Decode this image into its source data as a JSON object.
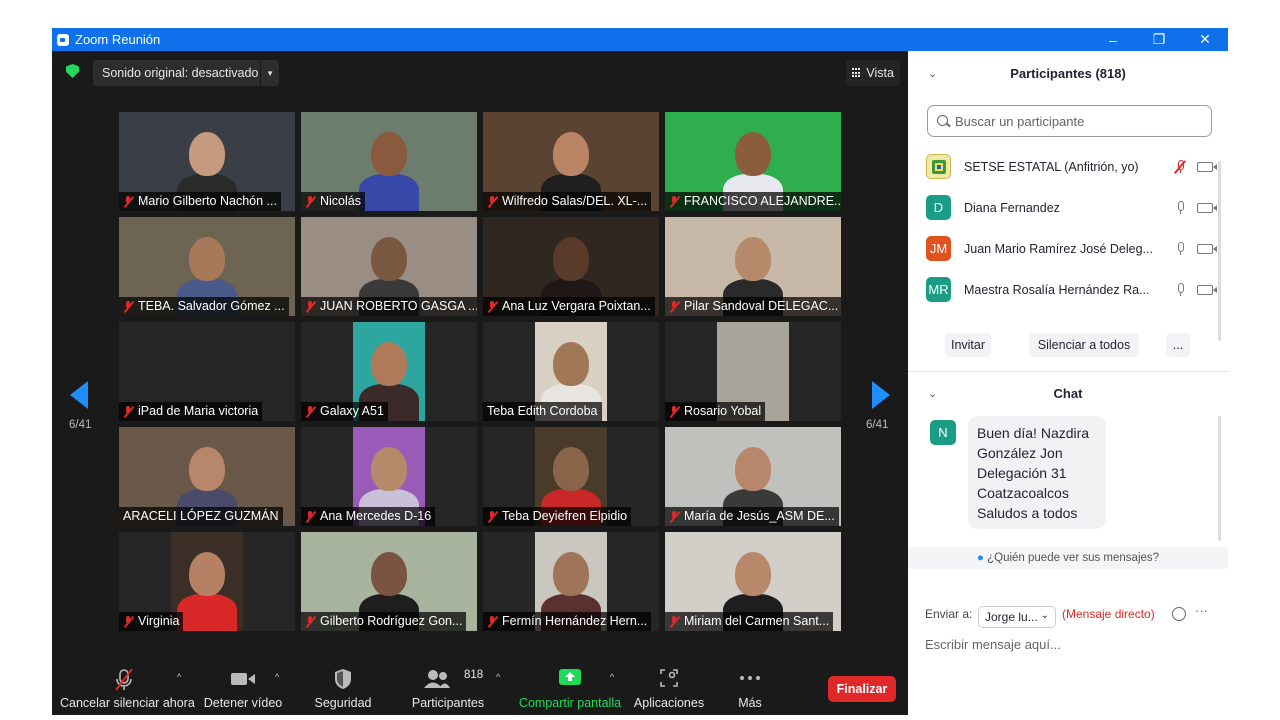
{
  "window": {
    "title": "Zoom Reunión",
    "controls": [
      "–",
      "❐",
      "✕"
    ]
  },
  "topbar": {
    "sound": "Sonido original: desactivado",
    "view": "Vista"
  },
  "pager": {
    "left": "6/41",
    "right": "6/41"
  },
  "tiles": [
    {
      "name": "Mario Gilberto Nachón ...",
      "muted": true,
      "bg": "#3a3f47",
      "skin": "#c69a7e",
      "shirt": "#2a2a2a"
    },
    {
      "name": "Nicolás",
      "muted": true,
      "bg": "#6c7d6e",
      "skin": "#8a5a3e",
      "shirt": "#3648a8"
    },
    {
      "name": "Wilfredo Salas/DEL. XL-...",
      "muted": true,
      "bg": "#5a4330",
      "skin": "#b98565",
      "shirt": "#1e1e1e"
    },
    {
      "name": "FRANCISCO ALEJANDRE...",
      "muted": true,
      "bg": "#2fae4e",
      "skin": "#8c5c3e",
      "shirt": "#e8e8f0"
    },
    {
      "name": "TEBA. Salvador Gómez ...",
      "muted": true,
      "bg": "#6e6452",
      "skin": "#a8785a",
      "shirt": "#4a5a8a"
    },
    {
      "name": "JUAN ROBERTO GASGA ...",
      "muted": true,
      "bg": "#9a8e84",
      "skin": "#7a5840",
      "shirt": "#3a3a3a"
    },
    {
      "name": "Ana Luz Vergara Poixtan...",
      "muted": true,
      "bg": "#302820",
      "skin": "#5a3a28",
      "shirt": "#201816"
    },
    {
      "name": "Pilar Sandoval DELEGAC...",
      "muted": true,
      "bg": "#c8b8a8",
      "skin": "#b58a6a",
      "shirt": "#2a2a2a"
    },
    {
      "name": "iPad de Maria victoria",
      "muted": true,
      "bg": "#262626",
      "skin": "",
      "shirt": ""
    },
    {
      "name": "Galaxy A51",
      "muted": true,
      "bg": "#2ea6a0",
      "skin": "#b07a5a",
      "shirt": "#3a2a2a"
    },
    {
      "name": "Teba Edith Cordoba",
      "muted": false,
      "bg": "#d8d0c2",
      "skin": "#a07858",
      "shirt": "#e8e4e0"
    },
    {
      "name": "Rosario Yobal",
      "muted": true,
      "bg": "#a8a49a",
      "skin": "",
      "shirt": ""
    },
    {
      "name": "ARACELI LÓPEZ GUZMÁN",
      "muted": false,
      "bg": "#6a5848",
      "skin": "#b8866a",
      "shirt": "#4a4a6a"
    },
    {
      "name": "Ana Mercedes D-16",
      "muted": true,
      "bg": "#9a5ab8",
      "skin": "#b58a6a",
      "shirt": "#c8c0d8"
    },
    {
      "name": "Teba Deyiefren Elpidio",
      "muted": true,
      "bg": "#4a3a2a",
      "skin": "#8a6448",
      "shirt": "#c82828"
    },
    {
      "name": "María de Jesús_ASM DE...",
      "muted": true,
      "bg": "#c0c0bc",
      "skin": "#b8866a",
      "shirt": "#3a3a3a"
    },
    {
      "name": "Virginia",
      "muted": true,
      "bg": "#3a2e26",
      "skin": "#b58064",
      "shirt": "#d82828"
    },
    {
      "name": "Gilberto Rodríguez Gon...",
      "muted": true,
      "bg": "#a8b49e",
      "skin": "#7a5440",
      "shirt": "#1e1e1e"
    },
    {
      "name": "Fermín Hernández Hern...",
      "muted": true,
      "bg": "#cac6c0",
      "skin": "#a07458",
      "shirt": "#5a3030"
    },
    {
      "name": "Miriam del Carmen Sant...",
      "muted": true,
      "bg": "#d2cec8",
      "skin": "#b8886a",
      "shirt": "#1e1e1e"
    }
  ],
  "toolbar": {
    "unmute": "Cancelar silenciar ahora",
    "video": "Detener vídeo",
    "security": "Seguridad",
    "participants": "Participantes",
    "participants_count": "818",
    "share": "Compartir pantalla",
    "apps": "Aplicaciones",
    "more": "Más",
    "end": "Finalizar"
  },
  "participants_panel": {
    "title": "Participantes (818)",
    "search_placeholder": "Buscar un participante",
    "rows": [
      {
        "initials": "",
        "color": "#f0e8a8",
        "name": "SETSE ESTATAL (Anfitrión, yo)",
        "mic_off": true
      },
      {
        "initials": "D",
        "color": "#1b9c85",
        "name": "Diana Fernandez",
        "mic_off": false
      },
      {
        "initials": "JM",
        "color": "#e0521e",
        "name": "Juan Mario Ramírez José Deleg...",
        "mic_off": false
      },
      {
        "initials": "MR",
        "color": "#1b9c85",
        "name": "Maestra Rosalía Hernández Ra...",
        "mic_off": false
      }
    ],
    "invite": "Invitar",
    "mute_all": "Silenciar a todos",
    "more": "..."
  },
  "chat_panel": {
    "title": "Chat",
    "message_avatar": "N",
    "message_lines": [
      "Buen día! Nazdira",
      "González Jon",
      "Delegación 31",
      "Coatzacoalcos",
      "Saludos a todos"
    ],
    "who_can_see": "¿Quién puede ver sus mensajes?",
    "send_to_label": "Enviar a:",
    "send_to_value": "Jorge lu...",
    "direct": "(Mensaje directo)",
    "input_placeholder": "Escribir mensaje aquí..."
  },
  "colors": {
    "title_bar": "#0e71eb",
    "accent_blue": "#1f8efa",
    "end_red": "#e02828",
    "share_green": "#23d959"
  }
}
